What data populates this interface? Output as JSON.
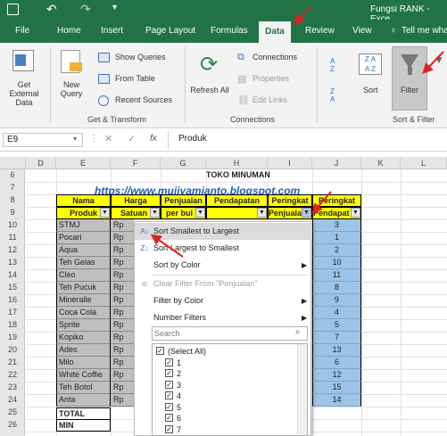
{
  "title_bar": {
    "text": "Fungsi RANK - Exce"
  },
  "tabs": [
    "File",
    "Home",
    "Insert",
    "Page Layout",
    "Formulas",
    "Data",
    "Review",
    "View"
  ],
  "tell_me": "Tell me wha",
  "ribbon": {
    "get_external": "Get External Data",
    "new_query": "New Query",
    "show_queries": "Show Queries",
    "from_table": "From Table",
    "recent_sources": "Recent Sources",
    "group1": "Get & Transform",
    "refresh_all": "Refresh All",
    "connections": "Connections",
    "properties": "Properties",
    "edit_links": "Edit Links",
    "group2": "Connections",
    "sort_az": "A Z",
    "sort_za": "Z A",
    "sort": "Sort",
    "filter": "Filter",
    "group3": "Sort & Filter"
  },
  "formula_bar": {
    "name_box": "E9",
    "fx": "fx",
    "value": "Produk"
  },
  "columns": [
    "D",
    "E",
    "F",
    "G",
    "H",
    "I",
    "J",
    "K",
    "L"
  ],
  "rows": [
    "6",
    "7",
    "8",
    "9",
    "10",
    "11",
    "12",
    "13",
    "14",
    "15",
    "16",
    "17",
    "18",
    "19",
    "20",
    "21",
    "22",
    "23",
    "24",
    "25",
    "26"
  ],
  "sheet": {
    "title": "TOKO  MINUMAN",
    "url": "https://www.mujiyamianto.blogspot.com",
    "hdr8": [
      "Nama",
      "Harga",
      "Penjualan",
      "Pendapatan",
      "Peringkat",
      "Peringkat"
    ],
    "hdr9": [
      "Produk",
      "Satuan",
      "per bul",
      "",
      "Penjuala",
      "Pendapat"
    ],
    "products": [
      "STMJ",
      "Pocari",
      "Aqua",
      "Teh Gelas",
      "Cleo",
      "Teh Pucuk",
      "Mineralle",
      "Coca Cola",
      "Sprite",
      "Kopiko",
      "Ades",
      "Milo",
      "White Coffie",
      "Teh Botol",
      "Anta"
    ],
    "rp": "Rp",
    "ranks": [
      "3",
      "1",
      "2",
      "10",
      "11",
      "8",
      "9",
      "4",
      "5",
      "7",
      "13",
      "6",
      "12",
      "15",
      "14"
    ],
    "total": "TOTAL",
    "min": "MIN"
  },
  "menu": {
    "items": [
      "Sort Smallest to Largest",
      "Sort Largest to Smallest",
      "Sort by Color",
      "Clear Filter From \"Penjualan\"",
      "Filter by Color",
      "Number Filters"
    ],
    "search_placeholder": "Search",
    "list": [
      "(Select All)",
      "1",
      "2",
      "3",
      "4",
      "5",
      "6",
      "7"
    ]
  },
  "colors": {
    "excel_green": "#217346",
    "header_yellow": "#ffff00",
    "cell_gray": "#bfbfbf",
    "rank_blue": "#9dc3e6",
    "arrow_red": "#e0201c"
  }
}
